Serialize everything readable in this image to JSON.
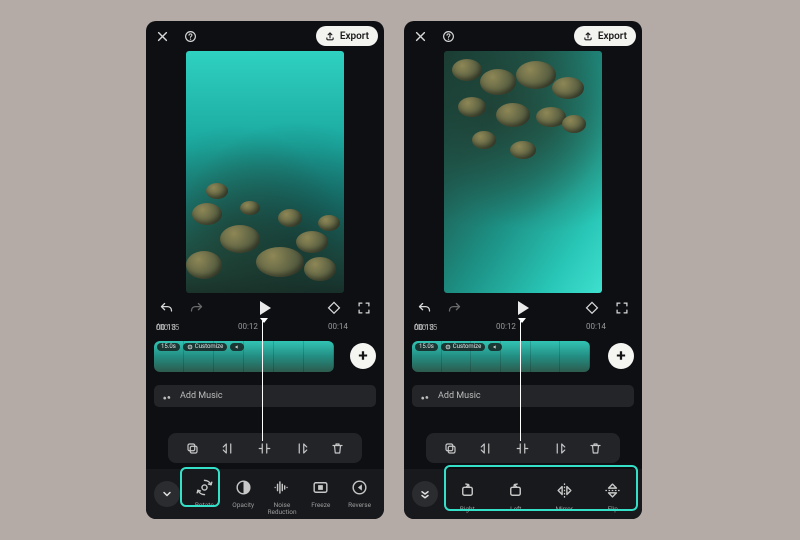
{
  "accent_color": "#35e0c8",
  "left": {
    "header": {
      "export_label": "Export"
    },
    "time": {
      "current": "00:13",
      "total": "00:15",
      "mark_a": "00:12",
      "mark_b": "00:14"
    },
    "clip": {
      "duration": "15.0s",
      "customize_label": "Customize"
    },
    "music_label": "Add Music",
    "tools": [
      {
        "key": "rotate",
        "label": "Rotate"
      },
      {
        "key": "opacity",
        "label": "Opacity"
      },
      {
        "key": "noise",
        "label": "Noise\nReduction"
      },
      {
        "key": "freeze",
        "label": "Freeze"
      },
      {
        "key": "reverse",
        "label": "Reverse"
      }
    ],
    "highlight_tool_index": 0
  },
  "right": {
    "header": {
      "export_label": "Export"
    },
    "time": {
      "current": "00:13",
      "total": "00:15",
      "mark_a": "00:12",
      "mark_b": "00:14"
    },
    "clip": {
      "duration": "15.0s",
      "customize_label": "Customize"
    },
    "music_label": "Add Music",
    "tools": [
      {
        "key": "rot-right",
        "label": "Right"
      },
      {
        "key": "rot-left",
        "label": "Left"
      },
      {
        "key": "mirror",
        "label": "Mirror"
      },
      {
        "key": "flip",
        "label": "Flip"
      }
    ],
    "highlight_all_tools": true
  }
}
